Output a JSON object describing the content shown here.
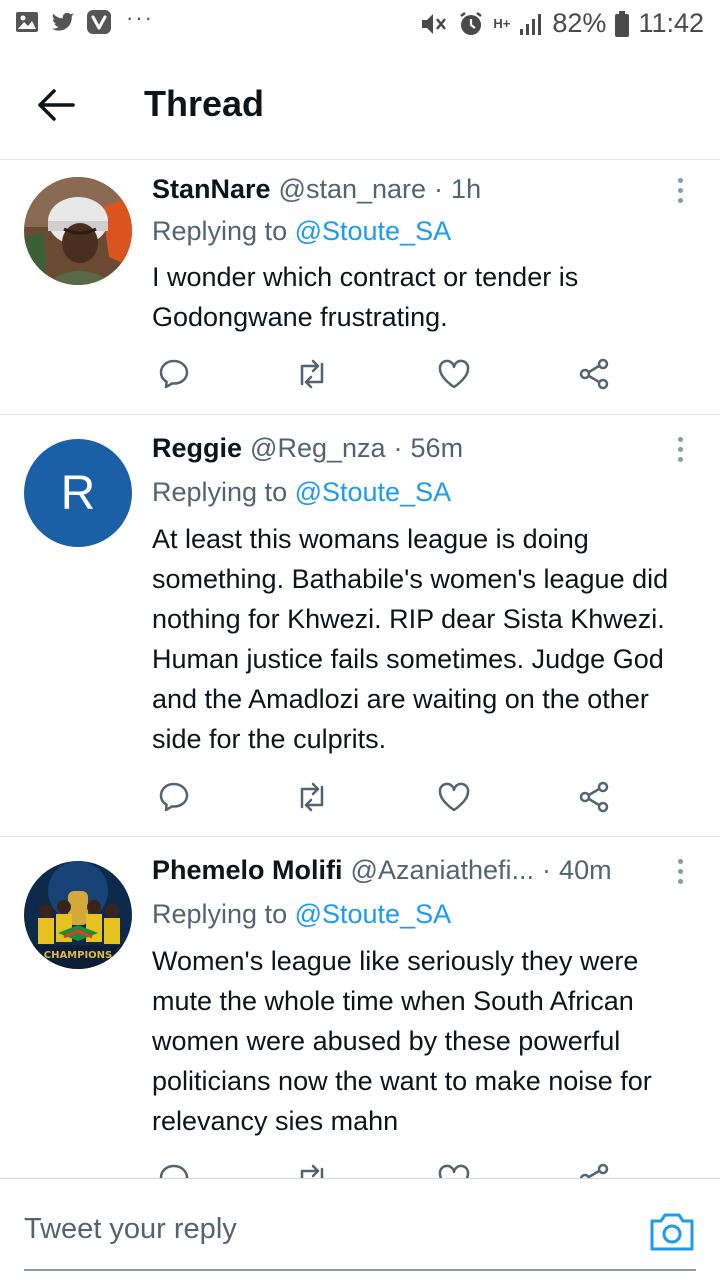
{
  "status_bar": {
    "battery": "82%",
    "time": "11:42",
    "network": "H+",
    "left_icons": [
      "gallery-icon",
      "twitter-bird-icon",
      "vivaldi-icon"
    ],
    "overflow": "···"
  },
  "header": {
    "title": "Thread"
  },
  "tweets": [
    {
      "name": "StanNare",
      "handle": "@stan_nare",
      "separator": "·",
      "time": "1h",
      "replying_prefix": "Replying to",
      "replying_to": "@Stoute_SA",
      "text": "I wonder which contract or tender is Godongwane frustrating."
    },
    {
      "name": "Reggie",
      "avatar_letter": "R",
      "handle": "@Reg_nza",
      "separator": "·",
      "time": "56m",
      "replying_prefix": "Replying to",
      "replying_to": "@Stoute_SA",
      "text": "At least this womans league is doing something. Bathabile's women's league did nothing for Khwezi. RIP dear Sista Khwezi. Human justice fails sometimes. Judge God and the Amadlozi are waiting on the other side for the culprits."
    },
    {
      "name": "Phemelo Molifi",
      "handle": "@Azaniathefi...",
      "separator": "·",
      "time": "40m",
      "replying_prefix": "Replying to",
      "replying_to": "@Stoute_SA",
      "avatar_text": "CHAMPIONS",
      "text": "Women's league like seriously they were mute the whole time when South African women were abused by these powerful politicians now the want to make noise for relevancy sies mahn"
    }
  ],
  "composer": {
    "placeholder": "Tweet your reply"
  },
  "colors": {
    "link": "#1d9bf0",
    "muted_text": "#536471",
    "avatar_letter_bg": "#1b5fa7",
    "divider": "#e4e8eb"
  }
}
